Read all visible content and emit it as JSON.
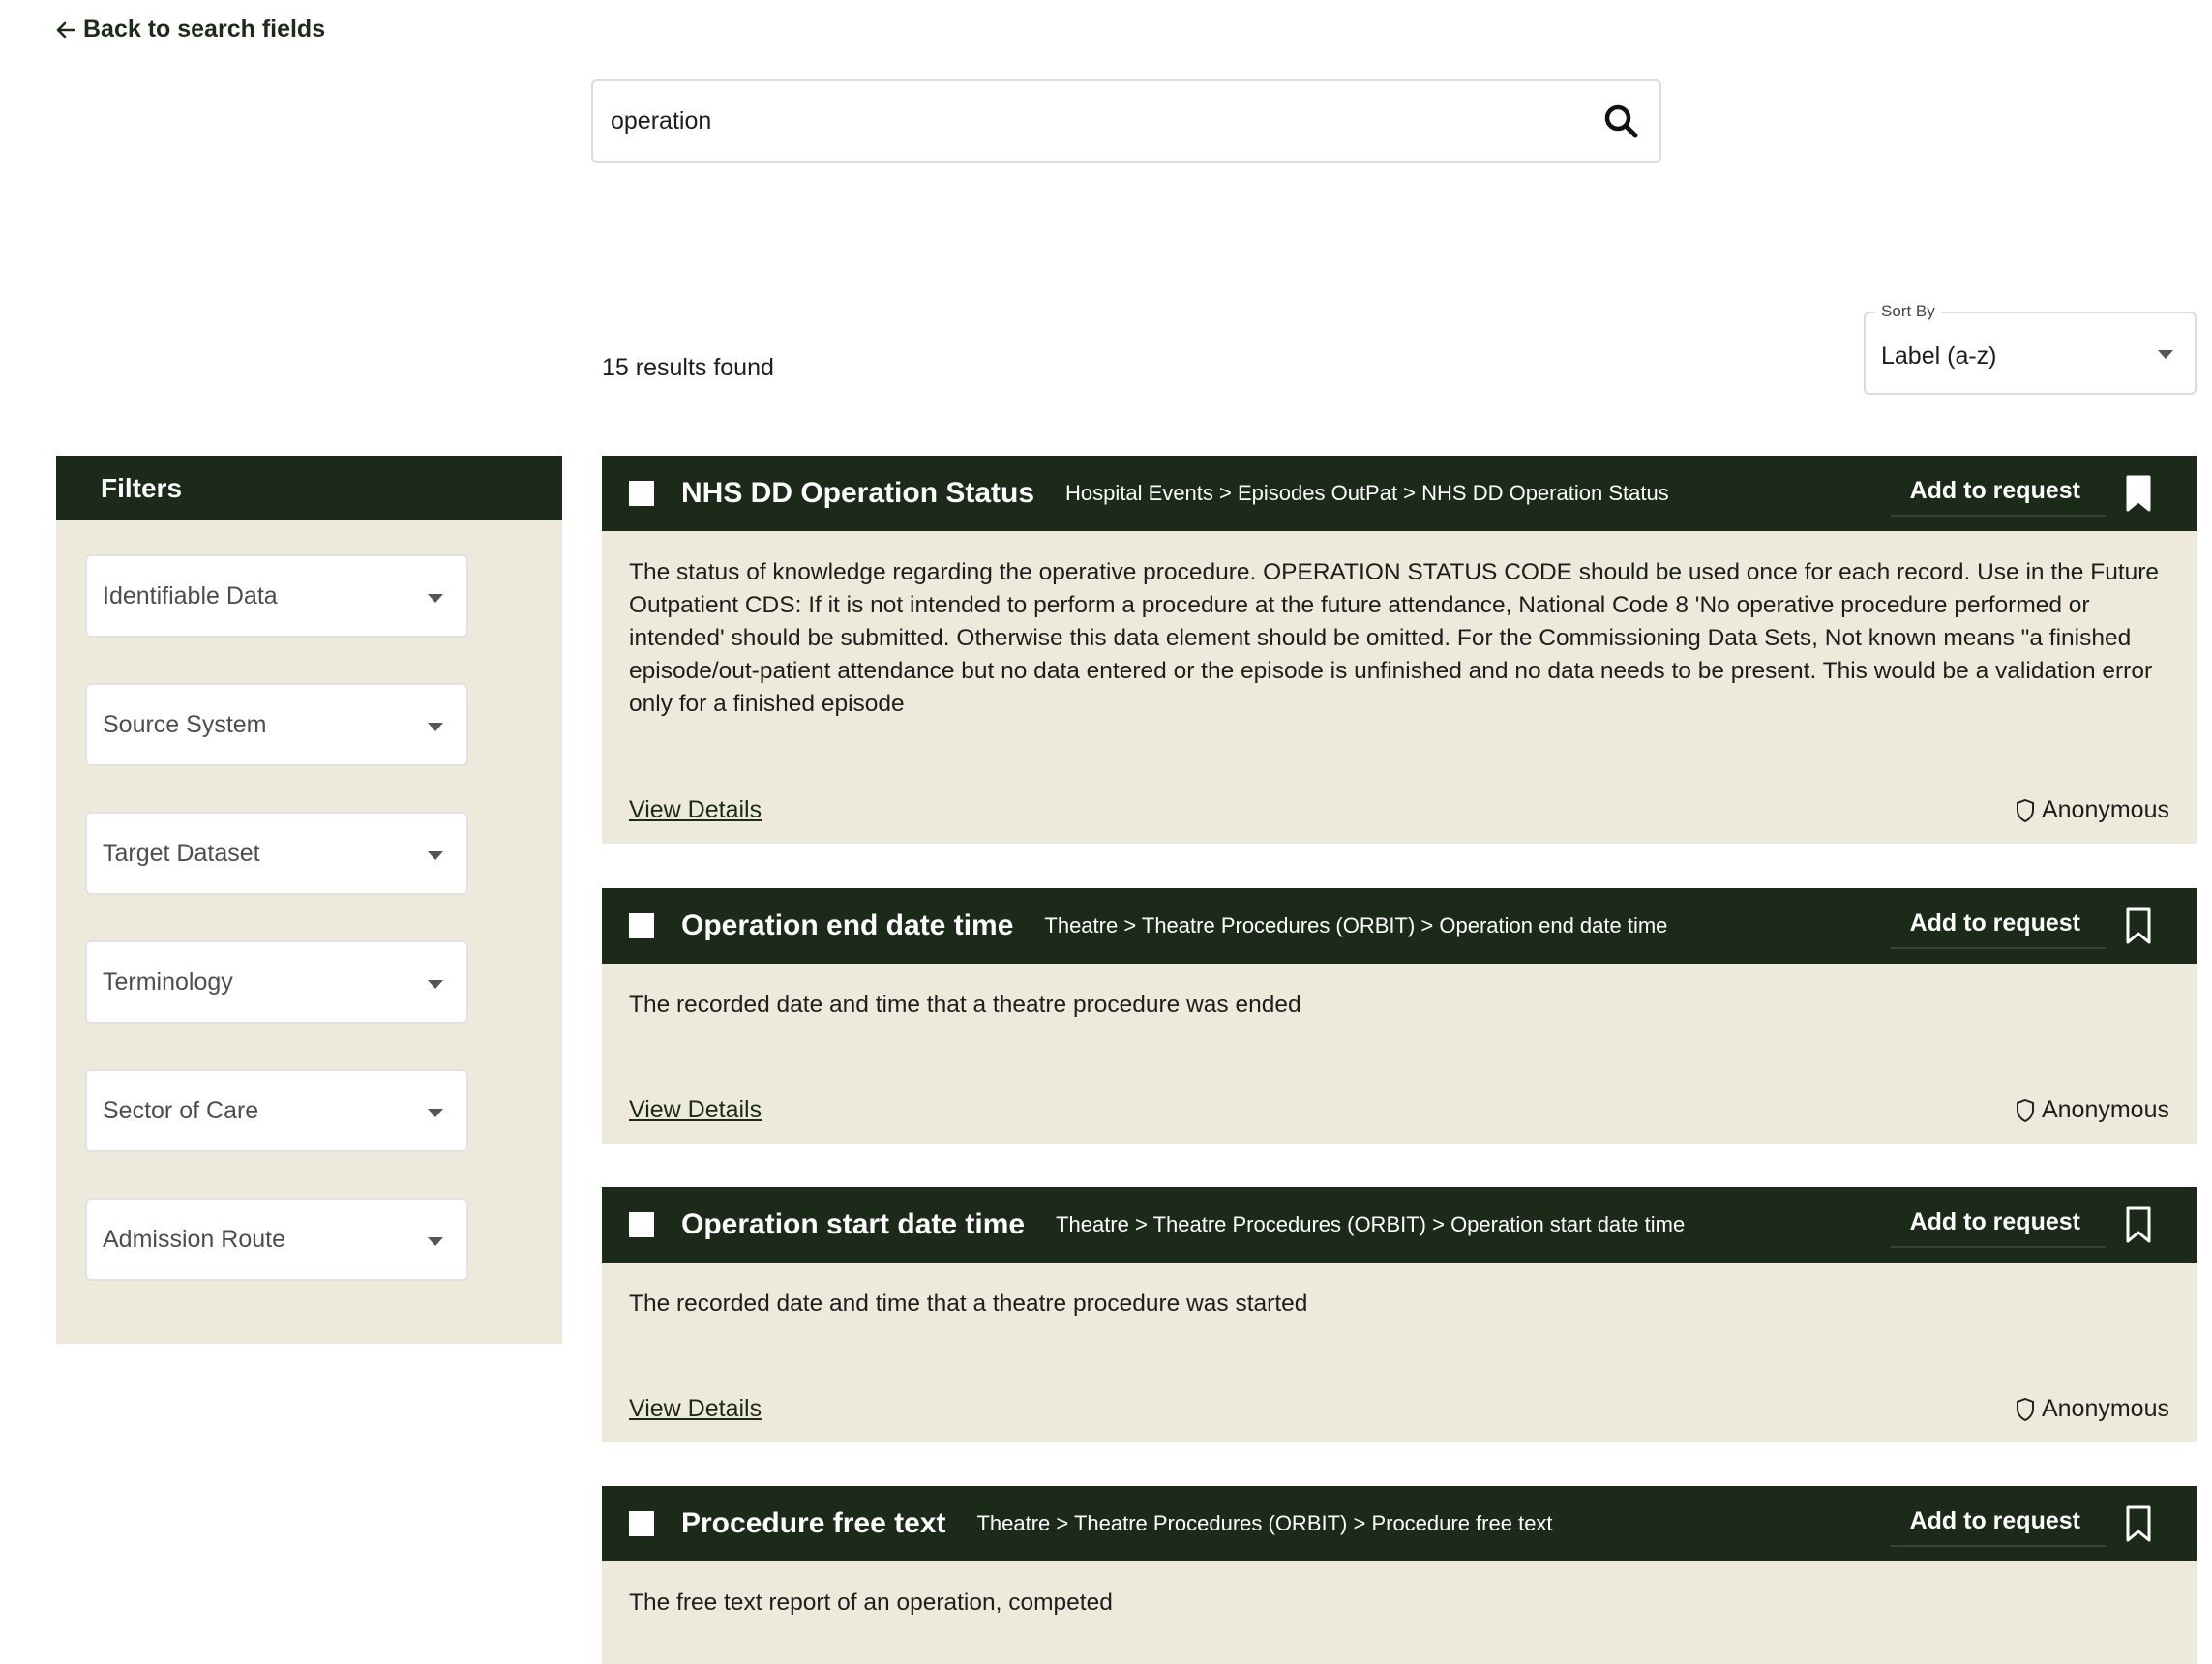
{
  "nav": {
    "back_label": "Back to search fields"
  },
  "search": {
    "query": "operation"
  },
  "results": {
    "count_text": "15 results found"
  },
  "sort": {
    "label": "Sort By",
    "value": "Label (a-z)"
  },
  "filters": {
    "title": "Filters",
    "items": [
      "Identifiable Data",
      "Source System",
      "Target Dataset",
      "Terminology",
      "Sector of Care",
      "Admission Route"
    ]
  },
  "card_common": {
    "add_label": "Add to request",
    "view_label": "View Details"
  },
  "cards": [
    {
      "title": "NHS DD Operation Status",
      "path": "Hospital Events > Episodes OutPat > NHS DD Operation Status",
      "description": "The status of knowledge regarding the operative procedure. OPERATION STATUS CODE should be used once for each record. Use in the Future Outpatient CDS: If it is not intended to perform a procedure at the future attendance, National Code 8 'No operative procedure performed or intended' should be submitted. Otherwise this data element should be omitted. For the Commissioning Data Sets, Not known means \"a finished episode/out-patient attendance but no data entered or the episode is unfinished and no data needs to be present. This would be a validation error only for a finished episode",
      "access": "Anonymous",
      "bookmarked": true
    },
    {
      "title": "Operation end date time",
      "path": "Theatre > Theatre Procedures (ORBIT) > Operation end date time",
      "description": "The recorded date and time that a theatre procedure was ended",
      "access": "Anonymous",
      "bookmarked": false
    },
    {
      "title": "Operation start date time",
      "path": "Theatre > Theatre Procedures (ORBIT) > Operation start date time",
      "description": "The recorded date and time that a theatre procedure was started",
      "access": "Anonymous",
      "bookmarked": false
    },
    {
      "title": "Procedure free text",
      "path": "Theatre > Theatre Procedures (ORBIT) > Procedure free text",
      "description": "The free text report of an operation, competed",
      "access": "",
      "bookmarked": false
    }
  ],
  "colors": {
    "header_bg": "#1b2a19",
    "panel_bg": "#eeeadb"
  }
}
